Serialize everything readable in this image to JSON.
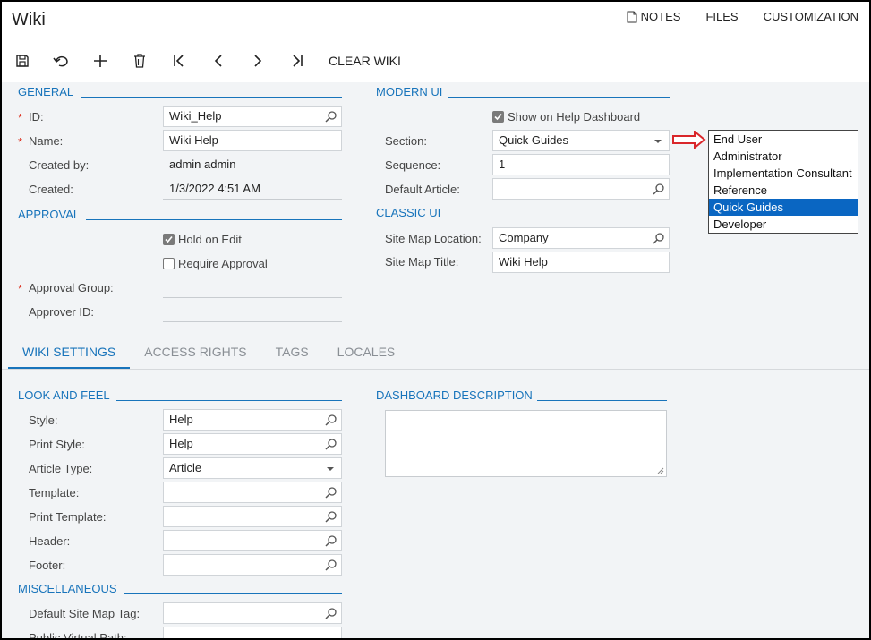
{
  "app": {
    "title": "Wiki"
  },
  "toplinks": {
    "notes": "NOTES",
    "files": "FILES",
    "customization": "CUSTOMIZATION"
  },
  "toolbar": {
    "clear_wiki": "CLEAR WIKI"
  },
  "general": {
    "title": "GENERAL",
    "id_label": "ID:",
    "id_value": "Wiki_Help",
    "name_label": "Name:",
    "name_value": "Wiki Help",
    "created_by_label": "Created by:",
    "created_by_value": "admin admin",
    "created_label": "Created:",
    "created_value": "1/3/2022 4:51 AM",
    "required_mark": "*"
  },
  "approval": {
    "title": "APPROVAL",
    "hold_on_edit": "Hold on Edit",
    "hold_on_edit_checked": true,
    "require_approval": "Require Approval",
    "require_approval_checked": false,
    "approval_group_label": "Approval Group:",
    "approver_id_label": "Approver ID:"
  },
  "modern_ui": {
    "title": "MODERN UI",
    "show_on_help_dashboard": "Show on Help Dashboard",
    "show_checked": true,
    "section_label": "Section:",
    "section_value": "Quick Guides",
    "sequence_label": "Sequence:",
    "sequence_value": "1",
    "default_article_label": "Default Article:"
  },
  "classic_ui": {
    "title": "CLASSIC UI",
    "site_map_location_label": "Site Map Location:",
    "site_map_location_value": "Company",
    "site_map_title_label": "Site Map Title:",
    "site_map_title_value": "Wiki Help"
  },
  "section_dropdown": {
    "options": [
      "End User",
      "Administrator",
      "Implementation Consultant",
      "Reference",
      "Quick Guides",
      "Developer"
    ],
    "selected": "Quick Guides"
  },
  "tabs": [
    {
      "label": "WIKI SETTINGS",
      "active": true
    },
    {
      "label": "ACCESS RIGHTS",
      "active": false
    },
    {
      "label": "TAGS",
      "active": false
    },
    {
      "label": "LOCALES",
      "active": false
    }
  ],
  "look_and_feel": {
    "title": "LOOK AND FEEL",
    "style_label": "Style:",
    "style_value": "Help",
    "print_style_label": "Print Style:",
    "print_style_value": "Help",
    "article_type_label": "Article Type:",
    "article_type_value": "Article",
    "template_label": "Template:",
    "print_template_label": "Print Template:",
    "header_label": "Header:",
    "footer_label": "Footer:"
  },
  "dashboard_description": {
    "title": "DASHBOARD DESCRIPTION"
  },
  "miscellaneous": {
    "title": "MISCELLANEOUS",
    "default_site_map_tag_label": "Default Site Map Tag:",
    "public_virtual_path_label": "Public Virtual Path:"
  },
  "colors": {
    "accent": "#1874bb",
    "selected_bg": "#0a66c2",
    "arrow": "#d9262a",
    "panel_bg": "#f2f4f6"
  }
}
